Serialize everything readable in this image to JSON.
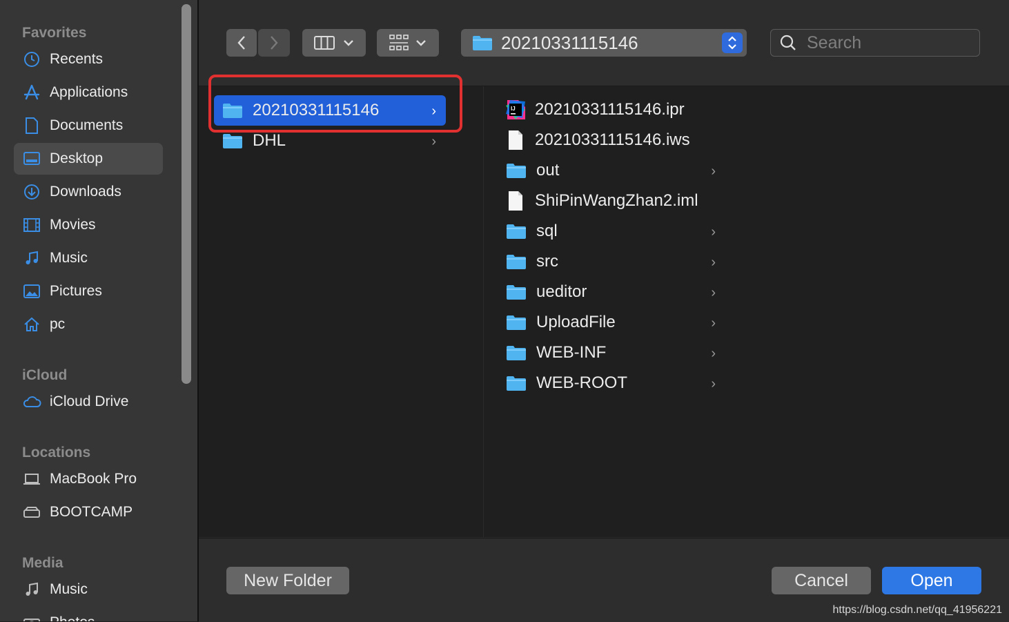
{
  "sidebar": {
    "favorites_header": "Favorites",
    "favorites": [
      {
        "label": "Recents",
        "icon": "clock-icon"
      },
      {
        "label": "Applications",
        "icon": "applications-icon"
      },
      {
        "label": "Documents",
        "icon": "document-icon"
      },
      {
        "label": "Desktop",
        "icon": "desktop-icon",
        "selected": true
      },
      {
        "label": "Downloads",
        "icon": "download-icon"
      },
      {
        "label": "Movies",
        "icon": "film-icon"
      },
      {
        "label": "Music",
        "icon": "music-note-icon"
      },
      {
        "label": "Pictures",
        "icon": "picture-icon"
      },
      {
        "label": "pc",
        "icon": "home-icon"
      }
    ],
    "icloud_header": "iCloud",
    "icloud": [
      {
        "label": "iCloud Drive",
        "icon": "cloud-icon"
      }
    ],
    "locations_header": "Locations",
    "locations": [
      {
        "label": "MacBook Pro",
        "icon": "laptop-icon"
      },
      {
        "label": "BOOTCAMP",
        "icon": "drive-icon"
      }
    ],
    "media_header": "Media",
    "media": [
      {
        "label": "Music",
        "icon": "music-note-icon"
      },
      {
        "label": "Photos",
        "icon": "camera-icon"
      }
    ]
  },
  "toolbar": {
    "path_label": "20210331115146",
    "search_placeholder": "Search"
  },
  "column1": [
    {
      "label": "20210331115146",
      "type": "folder",
      "selected": true
    },
    {
      "label": "DHL",
      "type": "folder"
    }
  ],
  "column2": [
    {
      "label": "20210331115146.ipr",
      "type": "ipr"
    },
    {
      "label": "20210331115146.iws",
      "type": "file"
    },
    {
      "label": "out",
      "type": "folder"
    },
    {
      "label": "ShiPinWangZhan2.iml",
      "type": "file"
    },
    {
      "label": "sql",
      "type": "folder"
    },
    {
      "label": "src",
      "type": "folder"
    },
    {
      "label": "ueditor",
      "type": "folder"
    },
    {
      "label": "UploadFile",
      "type": "folder"
    },
    {
      "label": "WEB-INF",
      "type": "folder"
    },
    {
      "label": "WEB-ROOT",
      "type": "folder"
    }
  ],
  "footer": {
    "new_folder": "New Folder",
    "cancel": "Cancel",
    "open": "Open",
    "watermark": "https://blog.csdn.net/qq_41956221"
  },
  "colors": {
    "accent": "#2160d8",
    "highlight_border": "#e03030",
    "folder": "#4fb4f0"
  }
}
